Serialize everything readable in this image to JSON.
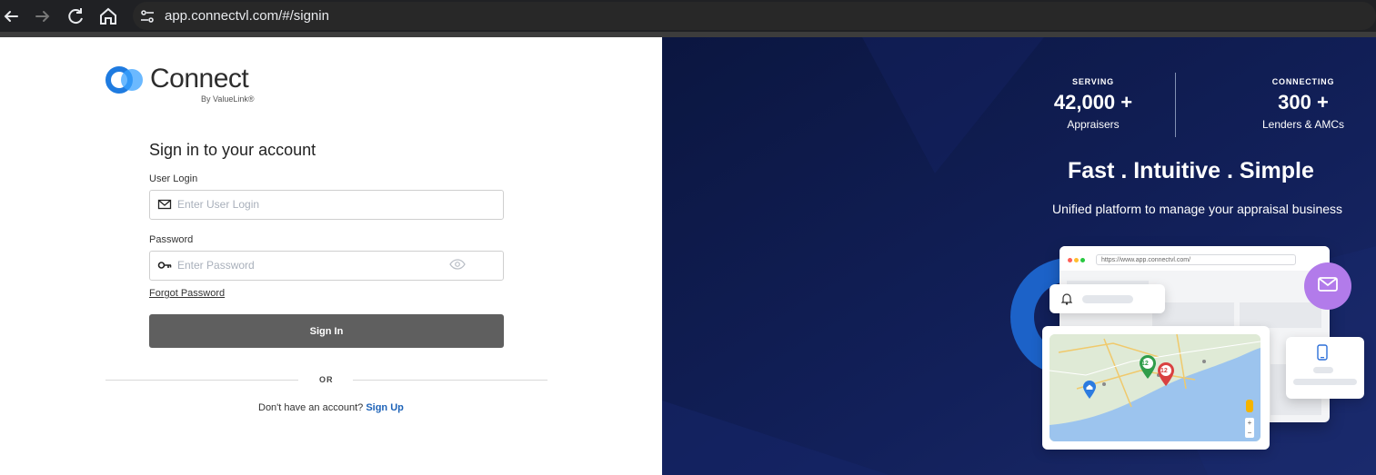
{
  "browser": {
    "url": "app.connectvl.com/#/signin",
    "icons": [
      "back-arrow-icon",
      "forward-arrow-icon",
      "reload-icon",
      "home-icon",
      "site-settings-icon"
    ]
  },
  "brand": {
    "name": "Connect",
    "byline": "By ValueLink®",
    "colors": {
      "blue": "#1f7be0",
      "dark_navy": "#0f1c4d",
      "button_gray": "#5f5f5f",
      "link_blue": "#1e63b8"
    }
  },
  "signin": {
    "title": "Sign in to your account",
    "user_login_label": "User Login",
    "user_login_placeholder": "Enter User Login",
    "user_login_value": "",
    "password_label": "Password",
    "password_placeholder": "Enter Password",
    "password_value": "",
    "forgot_password": "Forgot Password",
    "sign_in_button": "Sign In",
    "or_text": "OR",
    "no_account_text": "Don't have an account?",
    "sign_up_link": "Sign Up"
  },
  "promo": {
    "stats": [
      {
        "kicker": "SERVING",
        "value": "42,000 +",
        "caption": "Appraisers"
      },
      {
        "kicker": "CONNECTING",
        "value": "300 +",
        "caption": "Lenders & AMCs"
      }
    ],
    "headline": "Fast . Intuitive . Simple",
    "subheadline": "Unified platform to manage your appraisal business",
    "illustration": {
      "address_bar": "https://www.app.connectvl.com/",
      "markers": [
        "12",
        "12"
      ],
      "icons": [
        "bell-icon",
        "mail-icon",
        "mobile-phone-icon",
        "map-pin-icon",
        "home-pin-icon"
      ]
    }
  }
}
